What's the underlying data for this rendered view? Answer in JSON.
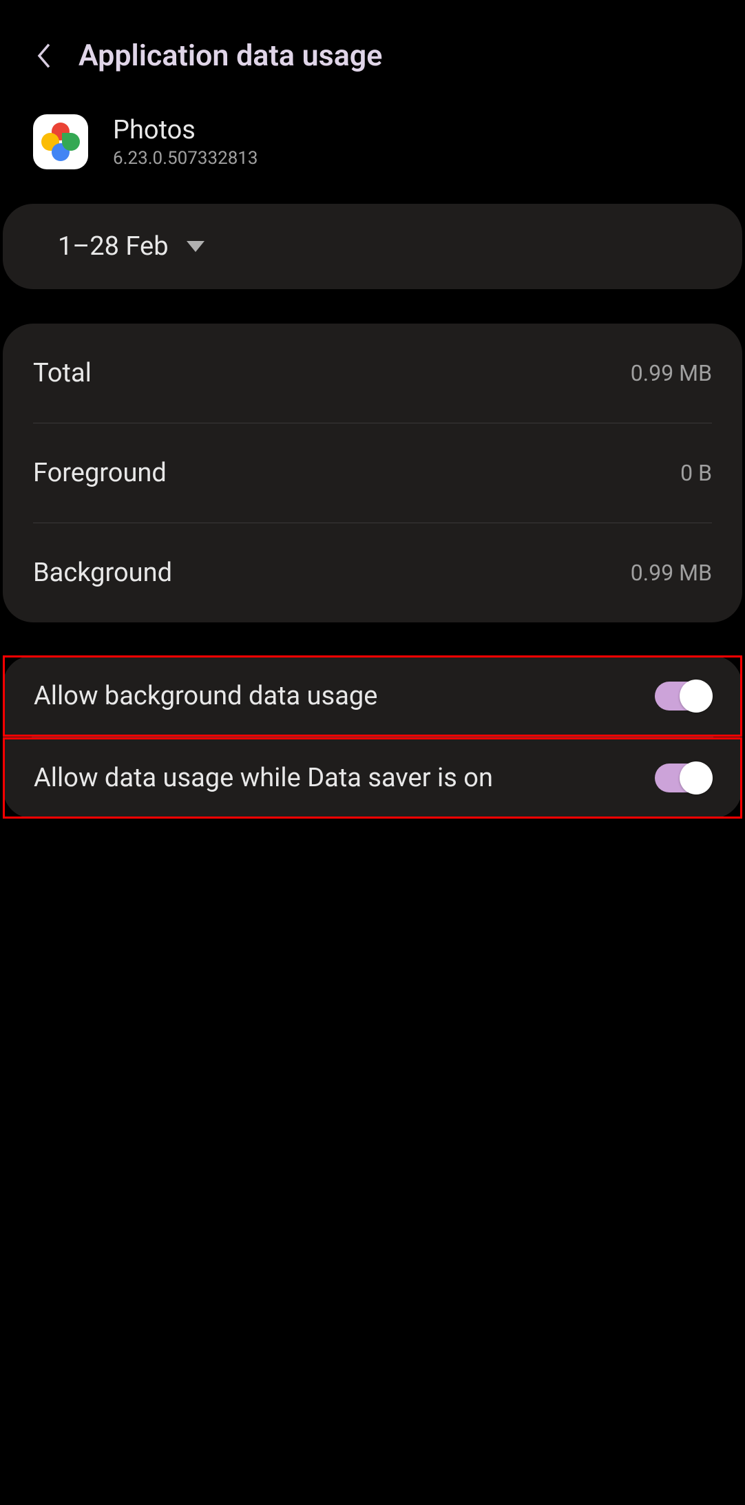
{
  "header": {
    "title": "Application data usage"
  },
  "app": {
    "name": "Photos",
    "version": "6.23.0.507332813"
  },
  "date_range": "1–28 Feb",
  "usage": {
    "total": {
      "label": "Total",
      "value": "0.99 MB"
    },
    "foreground": {
      "label": "Foreground",
      "value": "0 B"
    },
    "background": {
      "label": "Background",
      "value": "0.99 MB"
    }
  },
  "toggles": {
    "allow_background": {
      "label": "Allow background data usage",
      "on": true
    },
    "data_saver": {
      "label": "Allow data usage while Data saver is on",
      "on": true
    }
  }
}
